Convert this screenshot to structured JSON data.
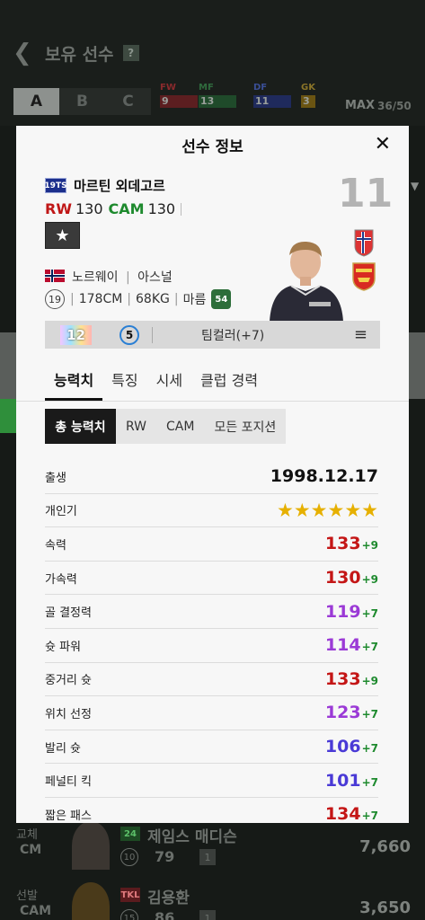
{
  "background": {
    "title": "보유 선수",
    "help": "?",
    "tabs": [
      "A",
      "B",
      "C"
    ],
    "positions": [
      {
        "label": "FW",
        "value": "9",
        "color": "#c0262b"
      },
      {
        "label": "MF",
        "value": "13",
        "color": "#1f8a3b"
      },
      {
        "label": "DF",
        "value": "11",
        "color": "#2946a8"
      },
      {
        "label": "GK",
        "value": "3",
        "color": "#c39a14"
      }
    ],
    "max_label": "MAX",
    "count": "36/50",
    "rows": [
      {
        "role": "교체",
        "pos": "CM",
        "tag": "24",
        "name": "제임스 매디슨",
        "ovr_badge": "10",
        "ovr": "79",
        "level": "1",
        "price": "7,660"
      },
      {
        "role": "선발",
        "pos": "CAM",
        "tag": "TKL",
        "name": "김용환",
        "ovr_badge": "15",
        "ovr": "86",
        "level": "1",
        "price": "3,650"
      }
    ]
  },
  "modal": {
    "title": "선수 정보",
    "close": "✕",
    "season": "19TS",
    "player_name": "마르틴 외데고르",
    "pos1": "RW",
    "pos1_val": "130",
    "pos2": "CAM",
    "pos2_val": "130",
    "back_number": "11",
    "star": "★",
    "nation": "노르웨이",
    "club": "아스널",
    "ovr_circle": "19",
    "height": "178CM",
    "weight": "68KG",
    "body": "마름",
    "feet": "54",
    "upgrade_grade": "12",
    "upgrade_count": "5",
    "team_color": "팀컬러(+7)",
    "menu": "≡",
    "tabs": [
      "능력치",
      "특징",
      "시세",
      "클럽 경력"
    ],
    "chips": [
      "총 능력치",
      "RW",
      "CAM",
      "모든 포지션"
    ],
    "birth_label": "출생",
    "birth": "1998.12.17",
    "popularity_label": "개인기",
    "popularity_stars": "★★★★★★",
    "stats": [
      {
        "label": "속력",
        "value": "133",
        "plus": "+9",
        "color": "#c41616"
      },
      {
        "label": "가속력",
        "value": "130",
        "plus": "+9",
        "color": "#c41616"
      },
      {
        "label": "골 결정력",
        "value": "119",
        "plus": "+7",
        "color": "#9b3ad6"
      },
      {
        "label": "슛 파워",
        "value": "114",
        "plus": "+7",
        "color": "#9b3ad6"
      },
      {
        "label": "중거리 슛",
        "value": "133",
        "plus": "+9",
        "color": "#c41616"
      },
      {
        "label": "위치 선정",
        "value": "123",
        "plus": "+7",
        "color": "#9b3ad6"
      },
      {
        "label": "발리 슛",
        "value": "106",
        "plus": "+7",
        "color": "#4a3ad6"
      },
      {
        "label": "페널티 킥",
        "value": "101",
        "plus": "+7",
        "color": "#4a3ad6"
      },
      {
        "label": "짧은 패스",
        "value": "134",
        "plus": "+7",
        "color": "#c41616"
      }
    ]
  }
}
